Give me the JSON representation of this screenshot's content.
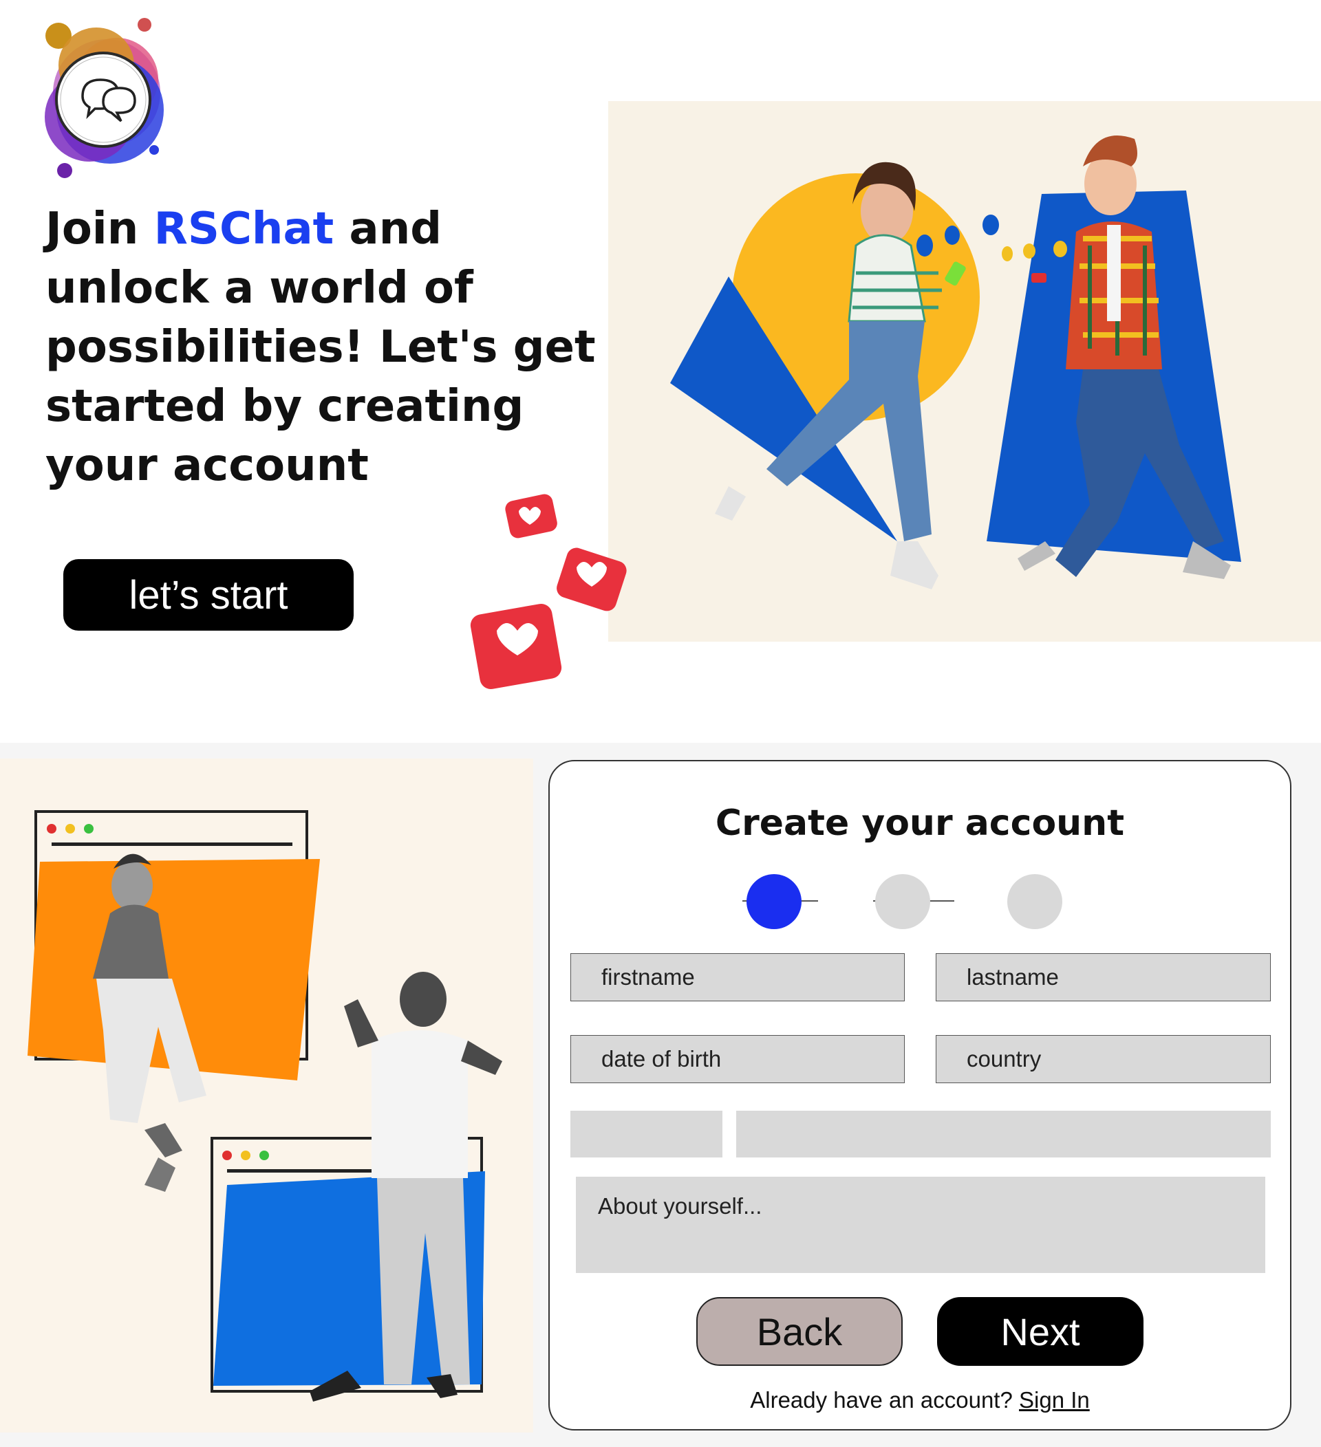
{
  "brand": {
    "name": "RSChat",
    "accent_color": "#1a3ff0",
    "logo_icon": "chat-bubbles-icon"
  },
  "hero": {
    "headline_before": "Join ",
    "headline_brand": "RSChat",
    "headline_after": " and unlock a world of possibilities! Let's get started by creating your account",
    "start_button": "let’s start",
    "illustration": "two-people-texting-illustration",
    "decoration": "heart-notification-icons"
  },
  "signup": {
    "title": "Create your account",
    "steps": {
      "total": 3,
      "current": 1,
      "active_color": "#1a2ef0",
      "inactive_color": "#d9d9d9"
    },
    "fields": {
      "firstname": "firstname",
      "lastname": "lastname",
      "dob": "date of birth",
      "country": "country",
      "about": "About yourself..."
    },
    "back_label": "Back",
    "next_label": "Next",
    "signin_prompt": "Already have an account? ",
    "signin_link": "Sign In"
  },
  "collage": {
    "illustration": "people-with-phones-browser-windows-collage"
  }
}
